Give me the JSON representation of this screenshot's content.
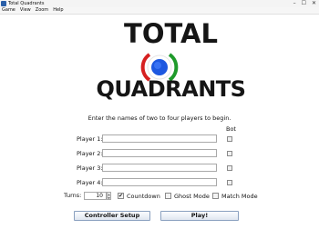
{
  "window": {
    "title": "Total Quadrants",
    "minimize": "–",
    "maximize": "☐",
    "close": "✕"
  },
  "menu": [
    "Game",
    "View",
    "Zoom",
    "Help"
  ],
  "logo": {
    "line1": "TOTAL",
    "line2": "QUADRANTS"
  },
  "instruction": "Enter the names of two to four players to begin.",
  "bot_header": "Bot",
  "players": [
    {
      "label": "Player 1:",
      "value": "",
      "bot": false
    },
    {
      "label": "Player 2:",
      "value": "",
      "bot": false
    },
    {
      "label": "Player 3:",
      "value": "",
      "bot": false
    },
    {
      "label": "Player 4:",
      "value": "",
      "bot": false
    }
  ],
  "options": {
    "turns_label": "Turns:",
    "turns_value": "10",
    "countdown": {
      "label": "Countdown",
      "checked": true
    },
    "ghost_mode": {
      "label": "Ghost Mode",
      "checked": false
    },
    "match_mode": {
      "label": "Match Mode",
      "checked": false
    }
  },
  "buttons": {
    "controller_setup": "Controller Setup",
    "play": "Play!"
  },
  "colors": {
    "ring_red": "#d62020",
    "ring_green": "#1e9a2a",
    "ring_blue": "#1d58e0",
    "logo_dark": "#151515"
  }
}
